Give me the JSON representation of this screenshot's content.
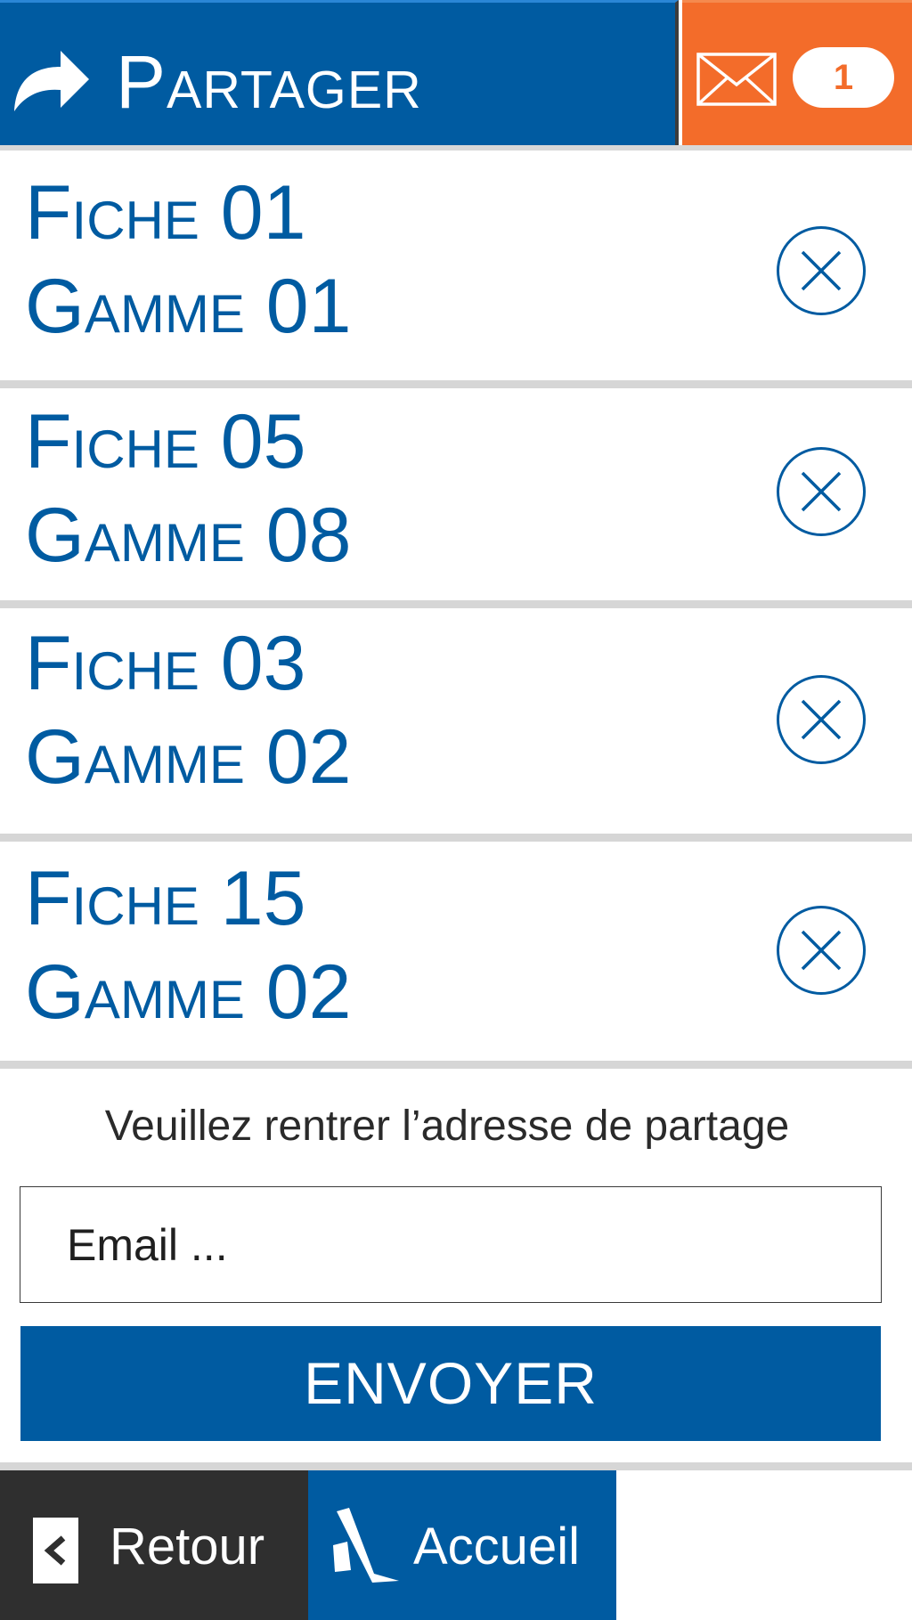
{
  "header": {
    "title": "Partager",
    "share_icon": "share-arrow-icon",
    "mail_icon": "envelope-icon",
    "mail_count": "1"
  },
  "colors": {
    "primary_blue": "#005ba1",
    "accent_orange": "#f36c2a",
    "dark_nav": "#2f2f2f",
    "separator": "#d6d6d6"
  },
  "items": [
    {
      "fiche": "Fiche 01",
      "gamme": "Gamme 01",
      "remove_icon": "close-circle-icon"
    },
    {
      "fiche": "Fiche 05",
      "gamme": "Gamme 08",
      "remove_icon": "close-circle-icon"
    },
    {
      "fiche": "Fiche 03",
      "gamme": "Gamme 02",
      "remove_icon": "close-circle-icon"
    },
    {
      "fiche": "Fiche 15",
      "gamme": "Gamme 02",
      "remove_icon": "close-circle-icon"
    }
  ],
  "form": {
    "label": "Veuillez rentrer l’adresse de partage",
    "email_placeholder": "Email ...",
    "email_value": "",
    "submit_label": "ENVOYER"
  },
  "nav": {
    "back_label": "Retour",
    "back_icon": "chevron-left-icon",
    "home_label": "Accueil",
    "home_icon": "brand-logo-icon"
  }
}
